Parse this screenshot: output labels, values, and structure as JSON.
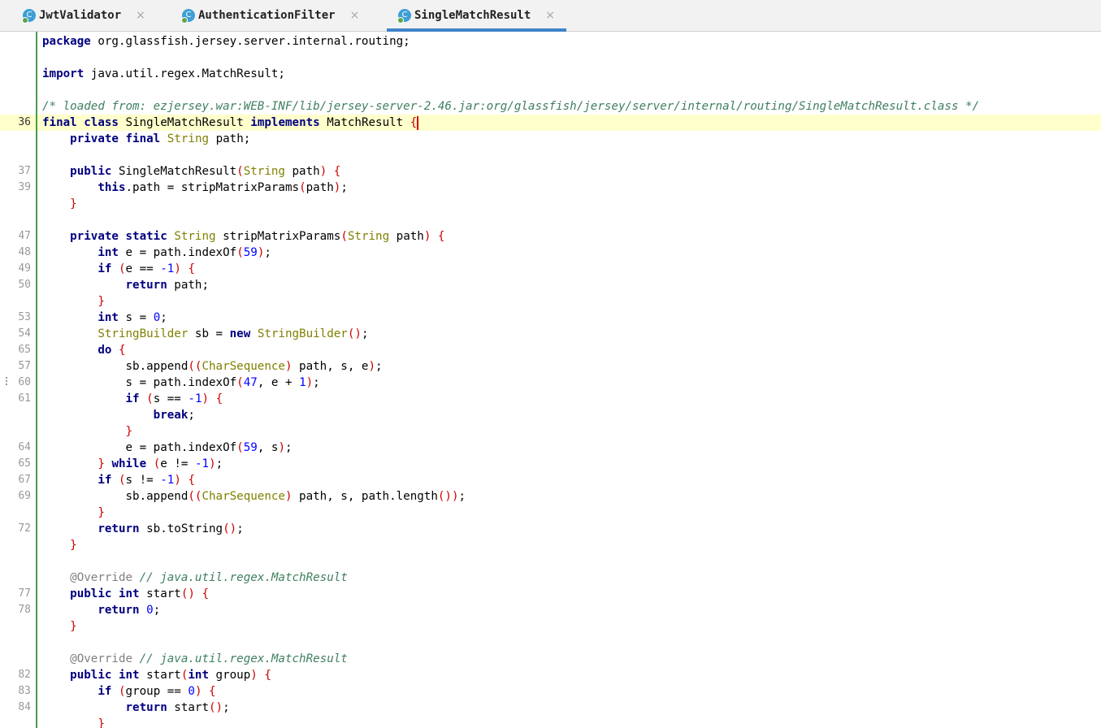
{
  "tabs": [
    {
      "label": "JwtValidator",
      "icon": "class-icon",
      "active": false
    },
    {
      "label": "AuthenticationFilter",
      "icon": "class-icon",
      "active": false
    },
    {
      "label": "SingleMatchResult",
      "icon": "class-icon",
      "active": true
    }
  ],
  "tab_icon_letter": "C",
  "tab_close_glyph": "×",
  "colors": {
    "keyword": "#000080",
    "type": "#808000",
    "punctuation": "#cc0000",
    "number": "#0000ff",
    "comment": "#3f7f5f",
    "annotation": "#808080",
    "current_line": "#ffffcc",
    "gutter_change_bar": "#4a9a4a",
    "active_tab_underline": "#4083c9",
    "caret": "#d00000"
  },
  "editor": {
    "current_line": 36,
    "lines": [
      {
        "num": "",
        "tokens": [
          [
            "kw",
            "package"
          ],
          [
            "t",
            " org.glassfish.jersey.server.internal.routing;"
          ]
        ]
      },
      {
        "num": "",
        "tokens": []
      },
      {
        "num": "",
        "tokens": [
          [
            "kw",
            "import"
          ],
          [
            "t",
            " java.util.regex.MatchResult;"
          ]
        ]
      },
      {
        "num": "",
        "tokens": []
      },
      {
        "num": "",
        "tokens": [
          [
            "cm",
            "/* loaded from: ezjersey.war:WEB-INF/lib/jersey-server-2.46.jar:org/glassfish/jersey/server/internal/routing/SingleMatchResult.class */"
          ]
        ]
      },
      {
        "num": "36",
        "tokens": [
          [
            "kw",
            "final"
          ],
          [
            "t",
            " "
          ],
          [
            "kw",
            "class"
          ],
          [
            "t",
            " SingleMatchResult "
          ],
          [
            "kw",
            "implements"
          ],
          [
            "t",
            " MatchResult "
          ],
          [
            "pu",
            "{"
          ],
          [
            "caret",
            ""
          ]
        ]
      },
      {
        "num": "",
        "tokens": [
          [
            "t",
            "    "
          ],
          [
            "kw",
            "private"
          ],
          [
            "t",
            " "
          ],
          [
            "kw",
            "final"
          ],
          [
            "t",
            " "
          ],
          [
            "ty",
            "String"
          ],
          [
            "t",
            " path;"
          ]
        ]
      },
      {
        "num": "",
        "tokens": []
      },
      {
        "num": "37",
        "tokens": [
          [
            "t",
            "    "
          ],
          [
            "kw",
            "public"
          ],
          [
            "t",
            " SingleMatchResult"
          ],
          [
            "pu",
            "("
          ],
          [
            "ty",
            "String"
          ],
          [
            "t",
            " path"
          ],
          [
            "pu",
            ")"
          ],
          [
            "t",
            " "
          ],
          [
            "pu",
            "{"
          ]
        ]
      },
      {
        "num": "39",
        "tokens": [
          [
            "t",
            "        "
          ],
          [
            "kw",
            "this"
          ],
          [
            "t",
            ".path = stripMatrixParams"
          ],
          [
            "pu",
            "("
          ],
          [
            "t",
            "path"
          ],
          [
            "pu",
            ")"
          ],
          [
            "t",
            ";"
          ]
        ]
      },
      {
        "num": "",
        "tokens": [
          [
            "t",
            "    "
          ],
          [
            "pu",
            "}"
          ]
        ]
      },
      {
        "num": "",
        "tokens": []
      },
      {
        "num": "47",
        "tokens": [
          [
            "t",
            "    "
          ],
          [
            "kw",
            "private"
          ],
          [
            "t",
            " "
          ],
          [
            "kw",
            "static"
          ],
          [
            "t",
            " "
          ],
          [
            "ty",
            "String"
          ],
          [
            "t",
            " stripMatrixParams"
          ],
          [
            "pu",
            "("
          ],
          [
            "ty",
            "String"
          ],
          [
            "t",
            " path"
          ],
          [
            "pu",
            ")"
          ],
          [
            "t",
            " "
          ],
          [
            "pu",
            "{"
          ]
        ]
      },
      {
        "num": "48",
        "tokens": [
          [
            "t",
            "        "
          ],
          [
            "kw",
            "int"
          ],
          [
            "t",
            " e = path.indexOf"
          ],
          [
            "pu",
            "("
          ],
          [
            "nu",
            "59"
          ],
          [
            "pu",
            ")"
          ],
          [
            "t",
            ";"
          ]
        ]
      },
      {
        "num": "49",
        "tokens": [
          [
            "t",
            "        "
          ],
          [
            "kw",
            "if"
          ],
          [
            "t",
            " "
          ],
          [
            "pu",
            "("
          ],
          [
            "t",
            "e == "
          ],
          [
            "nu",
            "-1"
          ],
          [
            "pu",
            ")"
          ],
          [
            "t",
            " "
          ],
          [
            "pu",
            "{"
          ]
        ]
      },
      {
        "num": "50",
        "tokens": [
          [
            "t",
            "            "
          ],
          [
            "kw",
            "return"
          ],
          [
            "t",
            " path;"
          ]
        ]
      },
      {
        "num": "",
        "tokens": [
          [
            "t",
            "        "
          ],
          [
            "pu",
            "}"
          ]
        ]
      },
      {
        "num": "53",
        "tokens": [
          [
            "t",
            "        "
          ],
          [
            "kw",
            "int"
          ],
          [
            "t",
            " s = "
          ],
          [
            "nu",
            "0"
          ],
          [
            "t",
            ";"
          ]
        ]
      },
      {
        "num": "54",
        "tokens": [
          [
            "t",
            "        "
          ],
          [
            "ty",
            "StringBuilder"
          ],
          [
            "t",
            " sb = "
          ],
          [
            "kw",
            "new"
          ],
          [
            "t",
            " "
          ],
          [
            "ty",
            "StringBuilder"
          ],
          [
            "pu",
            "()"
          ],
          [
            "t",
            ";"
          ]
        ]
      },
      {
        "num": "65",
        "tokens": [
          [
            "t",
            "        "
          ],
          [
            "kw",
            "do"
          ],
          [
            "t",
            " "
          ],
          [
            "pu",
            "{"
          ]
        ]
      },
      {
        "num": "57",
        "tokens": [
          [
            "t",
            "            sb.append"
          ],
          [
            "pu",
            "(("
          ],
          [
            "ty",
            "CharSequence"
          ],
          [
            "pu",
            ")"
          ],
          [
            "t",
            " path, s, e"
          ],
          [
            "pu",
            ")"
          ],
          [
            "t",
            ";"
          ]
        ]
      },
      {
        "num": "60",
        "tokens": [
          [
            "t",
            "            s = path.indexOf"
          ],
          [
            "pu",
            "("
          ],
          [
            "nu",
            "47"
          ],
          [
            "t",
            ", e + "
          ],
          [
            "nu",
            "1"
          ],
          [
            "pu",
            ")"
          ],
          [
            "t",
            ";"
          ]
        ]
      },
      {
        "num": "61",
        "tokens": [
          [
            "t",
            "            "
          ],
          [
            "kw",
            "if"
          ],
          [
            "t",
            " "
          ],
          [
            "pu",
            "("
          ],
          [
            "t",
            "s == "
          ],
          [
            "nu",
            "-1"
          ],
          [
            "pu",
            ")"
          ],
          [
            "t",
            " "
          ],
          [
            "pu",
            "{"
          ]
        ]
      },
      {
        "num": "",
        "tokens": [
          [
            "t",
            "                "
          ],
          [
            "kw",
            "break"
          ],
          [
            "t",
            ";"
          ]
        ]
      },
      {
        "num": "",
        "tokens": [
          [
            "t",
            "            "
          ],
          [
            "pu",
            "}"
          ]
        ]
      },
      {
        "num": "64",
        "tokens": [
          [
            "t",
            "            e = path.indexOf"
          ],
          [
            "pu",
            "("
          ],
          [
            "nu",
            "59"
          ],
          [
            "t",
            ", s"
          ],
          [
            "pu",
            ")"
          ],
          [
            "t",
            ";"
          ]
        ]
      },
      {
        "num": "65",
        "tokens": [
          [
            "t",
            "        "
          ],
          [
            "pu",
            "}"
          ],
          [
            "t",
            " "
          ],
          [
            "kw",
            "while"
          ],
          [
            "t",
            " "
          ],
          [
            "pu",
            "("
          ],
          [
            "t",
            "e != "
          ],
          [
            "nu",
            "-1"
          ],
          [
            "pu",
            ")"
          ],
          [
            "t",
            ";"
          ]
        ]
      },
      {
        "num": "67",
        "tokens": [
          [
            "t",
            "        "
          ],
          [
            "kw",
            "if"
          ],
          [
            "t",
            " "
          ],
          [
            "pu",
            "("
          ],
          [
            "t",
            "s != "
          ],
          [
            "nu",
            "-1"
          ],
          [
            "pu",
            ")"
          ],
          [
            "t",
            " "
          ],
          [
            "pu",
            "{"
          ]
        ]
      },
      {
        "num": "69",
        "tokens": [
          [
            "t",
            "            sb.append"
          ],
          [
            "pu",
            "(("
          ],
          [
            "ty",
            "CharSequence"
          ],
          [
            "pu",
            ")"
          ],
          [
            "t",
            " path, s, path.length"
          ],
          [
            "pu",
            "())"
          ],
          [
            "t",
            ";"
          ]
        ]
      },
      {
        "num": "",
        "tokens": [
          [
            "t",
            "        "
          ],
          [
            "pu",
            "}"
          ]
        ]
      },
      {
        "num": "72",
        "tokens": [
          [
            "t",
            "        "
          ],
          [
            "kw",
            "return"
          ],
          [
            "t",
            " sb.toString"
          ],
          [
            "pu",
            "()"
          ],
          [
            "t",
            ";"
          ]
        ]
      },
      {
        "num": "",
        "tokens": [
          [
            "t",
            "    "
          ],
          [
            "pu",
            "}"
          ]
        ]
      },
      {
        "num": "",
        "tokens": []
      },
      {
        "num": "",
        "tokens": [
          [
            "t",
            "    "
          ],
          [
            "an",
            "@Override"
          ],
          [
            "t",
            " "
          ],
          [
            "cm",
            "// java.util.regex.MatchResult"
          ]
        ]
      },
      {
        "num": "77",
        "tokens": [
          [
            "t",
            "    "
          ],
          [
            "kw",
            "public"
          ],
          [
            "t",
            " "
          ],
          [
            "kw",
            "int"
          ],
          [
            "t",
            " start"
          ],
          [
            "pu",
            "()"
          ],
          [
            "t",
            " "
          ],
          [
            "pu",
            "{"
          ]
        ]
      },
      {
        "num": "78",
        "tokens": [
          [
            "t",
            "        "
          ],
          [
            "kw",
            "return"
          ],
          [
            "t",
            " "
          ],
          [
            "nu",
            "0"
          ],
          [
            "t",
            ";"
          ]
        ]
      },
      {
        "num": "",
        "tokens": [
          [
            "t",
            "    "
          ],
          [
            "pu",
            "}"
          ]
        ]
      },
      {
        "num": "",
        "tokens": []
      },
      {
        "num": "",
        "tokens": [
          [
            "t",
            "    "
          ],
          [
            "an",
            "@Override"
          ],
          [
            "t",
            " "
          ],
          [
            "cm",
            "// java.util.regex.MatchResult"
          ]
        ]
      },
      {
        "num": "82",
        "tokens": [
          [
            "t",
            "    "
          ],
          [
            "kw",
            "public"
          ],
          [
            "t",
            " "
          ],
          [
            "kw",
            "int"
          ],
          [
            "t",
            " start"
          ],
          [
            "pu",
            "("
          ],
          [
            "kw",
            "int"
          ],
          [
            "t",
            " group"
          ],
          [
            "pu",
            ")"
          ],
          [
            "t",
            " "
          ],
          [
            "pu",
            "{"
          ]
        ]
      },
      {
        "num": "83",
        "tokens": [
          [
            "t",
            "        "
          ],
          [
            "kw",
            "if"
          ],
          [
            "t",
            " "
          ],
          [
            "pu",
            "("
          ],
          [
            "t",
            "group == "
          ],
          [
            "nu",
            "0"
          ],
          [
            "pu",
            ")"
          ],
          [
            "t",
            " "
          ],
          [
            "pu",
            "{"
          ]
        ]
      },
      {
        "num": "84",
        "tokens": [
          [
            "t",
            "            "
          ],
          [
            "kw",
            "return"
          ],
          [
            "t",
            " start"
          ],
          [
            "pu",
            "()"
          ],
          [
            "t",
            ";"
          ]
        ]
      },
      {
        "num": "",
        "tokens": [
          [
            "t",
            "        "
          ],
          [
            "pu",
            "}"
          ]
        ]
      }
    ]
  }
}
